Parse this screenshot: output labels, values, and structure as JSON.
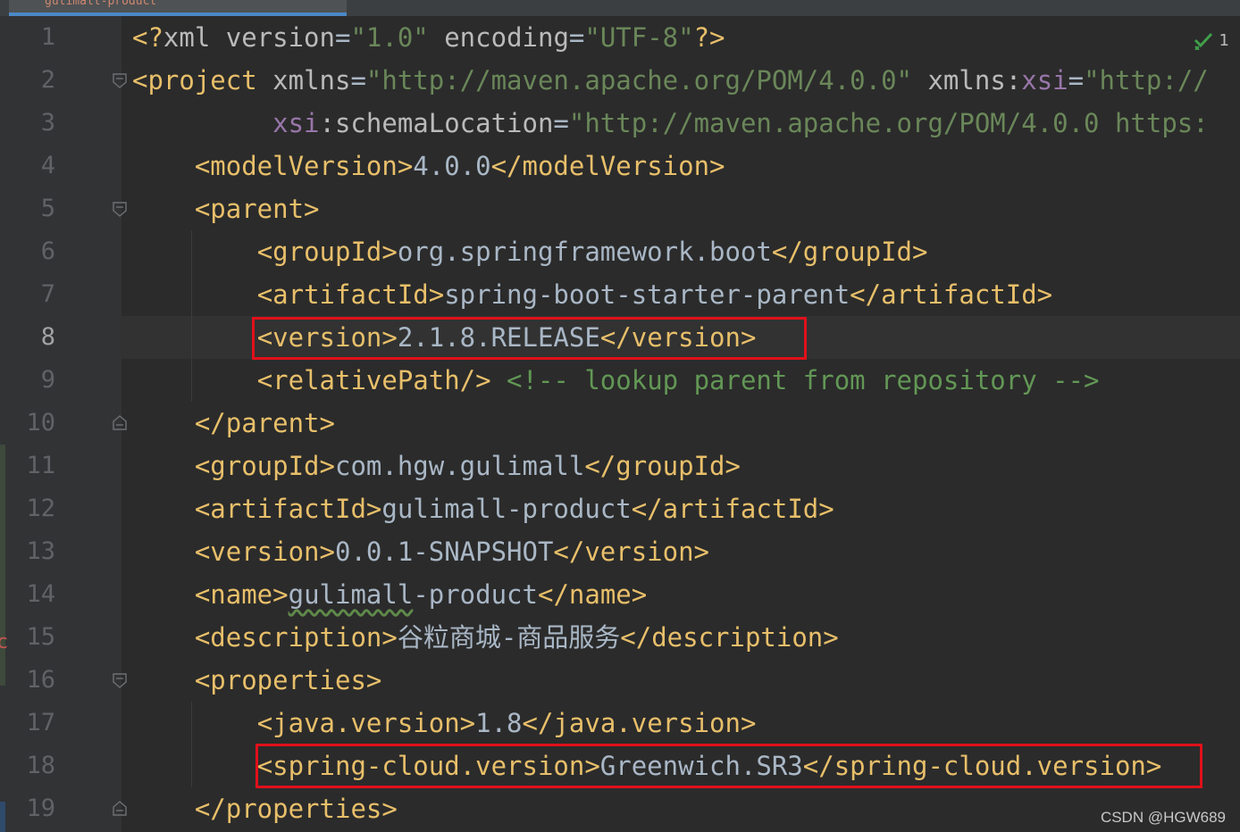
{
  "tab": {
    "label": "gulimall-product"
  },
  "inspection": {
    "count": "1",
    "icon": "check-icon"
  },
  "watermark": "CSDN @HGW689",
  "colors": {
    "background": "#2b2b2b",
    "gutter": "#313335",
    "tag": "#e8bf6a",
    "attribute": "#bababa",
    "string": "#6a8759",
    "namespace": "#9876aa",
    "comment": "#629755",
    "highlight_box": "#e0101a"
  },
  "editor": {
    "current_line": "8",
    "lines": [
      {
        "n": "1",
        "tokens": [
          {
            "k": "t",
            "v": "<?"
          },
          {
            "k": "a",
            "v": "xml version"
          },
          {
            "k": "v",
            "v": "="
          },
          {
            "k": "s",
            "v": "\"1.0\""
          },
          {
            "k": "a",
            "v": " encoding"
          },
          {
            "k": "v",
            "v": "="
          },
          {
            "k": "s",
            "v": "\"UTF-8\""
          },
          {
            "k": "t",
            "v": "?>"
          }
        ]
      },
      {
        "n": "2",
        "tokens": [
          {
            "k": "t",
            "v": "<project"
          },
          {
            "k": "a",
            "v": " xmlns"
          },
          {
            "k": "v",
            "v": "="
          },
          {
            "k": "s",
            "v": "\"http://maven.apache.org/POM/4.0.0\""
          },
          {
            "k": "a",
            "v": " xmlns:"
          },
          {
            "k": "ns",
            "v": "xsi"
          },
          {
            "k": "v",
            "v": "="
          },
          {
            "k": "s",
            "v": "\"http://"
          }
        ]
      },
      {
        "n": "3",
        "tokens": [
          {
            "k": "ns",
            "v": "         xsi"
          },
          {
            "k": "a",
            "v": ":schemaLocation"
          },
          {
            "k": "v",
            "v": "="
          },
          {
            "k": "s",
            "v": "\"http://maven.apache.org/POM/4.0.0 https:"
          }
        ]
      },
      {
        "n": "4",
        "tokens": [
          {
            "k": "v",
            "v": "    "
          },
          {
            "k": "t",
            "v": "<modelVersion>"
          },
          {
            "k": "v",
            "v": "4.0.0"
          },
          {
            "k": "t",
            "v": "</modelVersion>"
          }
        ]
      },
      {
        "n": "5",
        "tokens": [
          {
            "k": "v",
            "v": "    "
          },
          {
            "k": "t",
            "v": "<parent>"
          }
        ]
      },
      {
        "n": "6",
        "tokens": [
          {
            "k": "v",
            "v": "        "
          },
          {
            "k": "t",
            "v": "<groupId>"
          },
          {
            "k": "v",
            "v": "org.springframework.boot"
          },
          {
            "k": "t",
            "v": "</groupId>"
          }
        ]
      },
      {
        "n": "7",
        "tokens": [
          {
            "k": "v",
            "v": "        "
          },
          {
            "k": "t",
            "v": "<artifactId>"
          },
          {
            "k": "v",
            "v": "spring-boot-starter-parent"
          },
          {
            "k": "t",
            "v": "</artifactId>"
          }
        ]
      },
      {
        "n": "8",
        "tokens": [
          {
            "k": "v",
            "v": "        "
          },
          {
            "k": "t",
            "v": "<version>"
          },
          {
            "k": "v",
            "v": "2.1.8.RELEASE"
          },
          {
            "k": "t",
            "v": "</version>"
          }
        ]
      },
      {
        "n": "9",
        "tokens": [
          {
            "k": "v",
            "v": "        "
          },
          {
            "k": "t",
            "v": "<relativePath/>"
          },
          {
            "k": "c",
            "v": " <!-- lookup parent from repository -->"
          }
        ]
      },
      {
        "n": "10",
        "tokens": [
          {
            "k": "v",
            "v": "    "
          },
          {
            "k": "t",
            "v": "</parent>"
          }
        ]
      },
      {
        "n": "11",
        "tokens": [
          {
            "k": "v",
            "v": "    "
          },
          {
            "k": "t",
            "v": "<groupId>"
          },
          {
            "k": "v",
            "v": "com.hgw.gulimall"
          },
          {
            "k": "t",
            "v": "</groupId>"
          }
        ]
      },
      {
        "n": "12",
        "tokens": [
          {
            "k": "v",
            "v": "    "
          },
          {
            "k": "t",
            "v": "<artifactId>"
          },
          {
            "k": "v",
            "v": "gulimall-product"
          },
          {
            "k": "t",
            "v": "</artifactId>"
          }
        ]
      },
      {
        "n": "13",
        "tokens": [
          {
            "k": "v",
            "v": "    "
          },
          {
            "k": "t",
            "v": "<version>"
          },
          {
            "k": "v",
            "v": "0.0.1-SNAPSHOT"
          },
          {
            "k": "t",
            "v": "</version>"
          }
        ]
      },
      {
        "n": "14",
        "tokens": [
          {
            "k": "v",
            "v": "    "
          },
          {
            "k": "t",
            "v": "<name>"
          },
          {
            "k": "typo",
            "v": "gulimall"
          },
          {
            "k": "v",
            "v": "-product"
          },
          {
            "k": "t",
            "v": "</name>"
          }
        ]
      },
      {
        "n": "15",
        "tokens": [
          {
            "k": "v",
            "v": "    "
          },
          {
            "k": "t",
            "v": "<description>"
          },
          {
            "k": "v",
            "v": "谷粒商城-商品服务"
          },
          {
            "k": "t",
            "v": "</description>"
          }
        ]
      },
      {
        "n": "16",
        "tokens": [
          {
            "k": "v",
            "v": "    "
          },
          {
            "k": "t",
            "v": "<properties>"
          }
        ]
      },
      {
        "n": "17",
        "tokens": [
          {
            "k": "v",
            "v": "        "
          },
          {
            "k": "t",
            "v": "<java.version>"
          },
          {
            "k": "v",
            "v": "1.8"
          },
          {
            "k": "t",
            "v": "</java.version>"
          }
        ]
      },
      {
        "n": "18",
        "tokens": [
          {
            "k": "v",
            "v": "        "
          },
          {
            "k": "t",
            "v": "<spring-cloud.version>"
          },
          {
            "k": "v",
            "v": "Greenwich.SR3"
          },
          {
            "k": "t",
            "v": "</spring-cloud.version>"
          }
        ]
      },
      {
        "n": "19",
        "tokens": [
          {
            "k": "v",
            "v": "    "
          },
          {
            "k": "t",
            "v": "</properties>"
          }
        ]
      }
    ]
  }
}
